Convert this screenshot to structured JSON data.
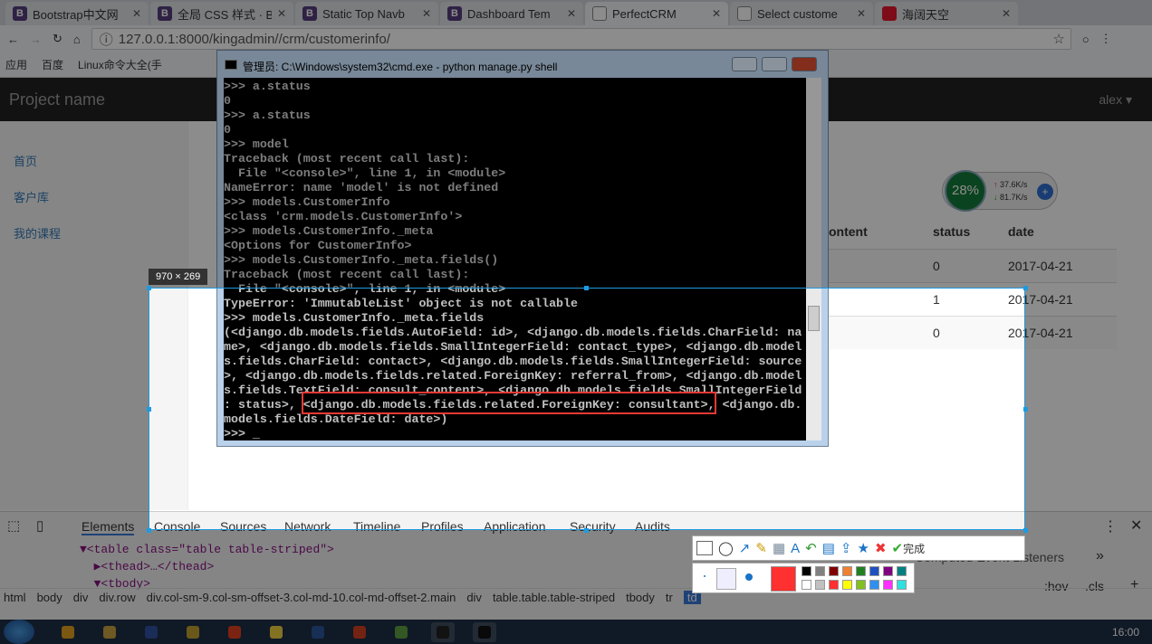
{
  "browser": {
    "tabs": [
      {
        "label": "Bootstrap中文网",
        "icon": "bootstrap-icon"
      },
      {
        "label": "全局 CSS 样式 · B",
        "icon": "bootstrap-icon"
      },
      {
        "label": "Static Top Navb",
        "icon": "bootstrap-icon"
      },
      {
        "label": "Dashboard Tem",
        "icon": "bootstrap-icon"
      },
      {
        "label": "PerfectCRM",
        "icon": "page-icon",
        "active": true
      },
      {
        "label": "Select custome",
        "icon": "page-icon"
      },
      {
        "label": "海阔天空",
        "icon": "weibo-icon"
      }
    ],
    "url": "127.0.0.1:8000/kingadmin//crm/customerinfo/",
    "bookmarks": [
      "应用",
      "百度",
      "Linux命令大全(手"
    ]
  },
  "app": {
    "brand": "Project name",
    "user": "alex",
    "sidebar": [
      "首页",
      "客户库",
      "我的课程"
    ],
    "table": {
      "headers": [
        "ontent",
        "status",
        "date"
      ],
      "rows": [
        [
          "0",
          "2017-04-21"
        ],
        [
          "1",
          "2017-04-21"
        ],
        [
          "0",
          "2017-04-21"
        ]
      ]
    }
  },
  "netmeter": {
    "percent": "28%",
    "up": "37.6K/s",
    "down": "81.7K/s"
  },
  "cmd": {
    "title": "管理员: C:\\Windows\\system32\\cmd.exe - python  manage.py shell",
    "lines": [
      ">>> a.status",
      "0",
      ">>> a.status",
      "0",
      ">>> model",
      "Traceback (most recent call last):",
      "  File \"<console>\", line 1, in <module>",
      "NameError: name 'model' is not defined",
      ">>> models.CustomerInfo",
      "<class 'crm.models.CustomerInfo'>",
      ">>> models.CustomerInfo._meta",
      "<Options for CustomerInfo>",
      ">>> models.CustomerInfo._meta.fields()",
      "Traceback (most recent call last):",
      "  File \"<console>\", line 1, in <module>",
      "TypeError: 'ImmutableList' object is not callable",
      ">>> models.CustomerInfo._meta.fields",
      "(<django.db.models.fields.AutoField: id>, <django.db.models.fields.CharField: na",
      "me>, <django.db.models.fields.SmallIntegerField: contact_type>, <django.db.model",
      "s.fields.CharField: contact>, <django.db.models.fields.SmallIntegerField: source",
      ">, <django.db.models.fields.related.ForeignKey: referral_from>, <django.db.model",
      "s.fields.TextField: consult_content>, <django.db.models.fields.SmallIntegerField",
      ": status>, <django.db.models.fields.related.ForeignKey: consultant>, <django.db.",
      "models.fields.DateField: date>)",
      ">>> _"
    ]
  },
  "devtools": {
    "tabs": [
      "Elements",
      "Console",
      "Sources",
      "Network",
      "Timeline",
      "Profiles",
      "Application",
      "Security",
      "Audits"
    ],
    "tree": [
      "▼<table class=\"table table-striped\">",
      "  ▶<thead>…</thead>",
      "  ▼<tbody>"
    ],
    "breadcrumbs": [
      "html",
      "body",
      "div",
      "div.row",
      "div.col-sm-9.col-sm-offset-3.col-md-10.col-md-offset-2.main",
      "div",
      "table.table.table-striped",
      "tbody",
      "tr",
      "td"
    ],
    "side_tabs": "Computed   Event Listeners",
    "hov": ":hov",
    "cls": ".cls"
  },
  "capture": {
    "size": "970 × 269",
    "done": "完成",
    "colors": [
      "#000000",
      "#808080",
      "#800000",
      "#f08030",
      "#208020",
      "#2050c0",
      "#800080",
      "#008080",
      "#ffffff",
      "#c0c0c0",
      "#ff3030",
      "#ffff00",
      "#80c020",
      "#3090f0",
      "#ff30ff",
      "#30e0e0"
    ],
    "current_color": "#ff3030"
  },
  "taskbar": {
    "time": "16:00"
  }
}
